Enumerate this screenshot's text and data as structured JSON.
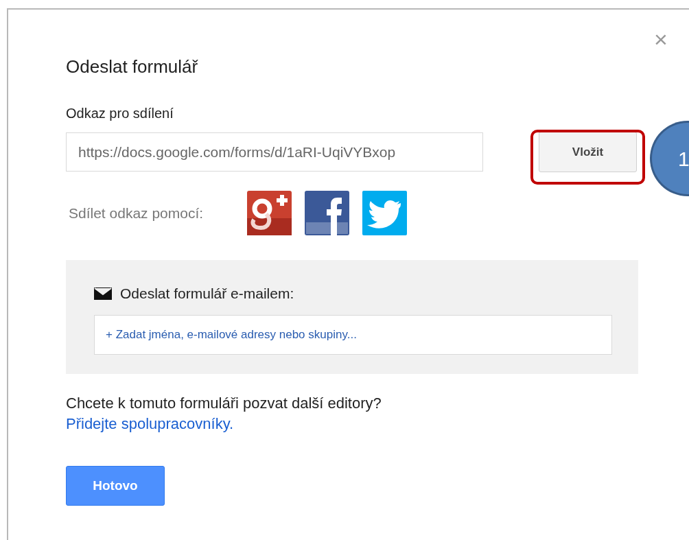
{
  "dialog": {
    "title": "Odeslat formulář",
    "close": "×"
  },
  "share_link": {
    "label": "Odkaz pro sdílení",
    "value": "https://docs.google.com/forms/d/1aRI-UqiVYBxop",
    "button": "Vložit"
  },
  "share_via": {
    "label": "Sdílet odkaz pomocí:",
    "services": [
      {
        "kind": "googleplus"
      },
      {
        "kind": "facebook"
      },
      {
        "kind": "twitter"
      }
    ]
  },
  "email": {
    "label": "Odeslat formulář e-mailem:",
    "placeholder": "+ Zadat jména, e-mailové adresy nebo skupiny..."
  },
  "invite": {
    "text": "Chcete k tomuto formuláři pozvat další editory?",
    "link": "Přidejte spolupracovníky."
  },
  "done_button": "Hotovo",
  "annotation": {
    "number": "1"
  }
}
